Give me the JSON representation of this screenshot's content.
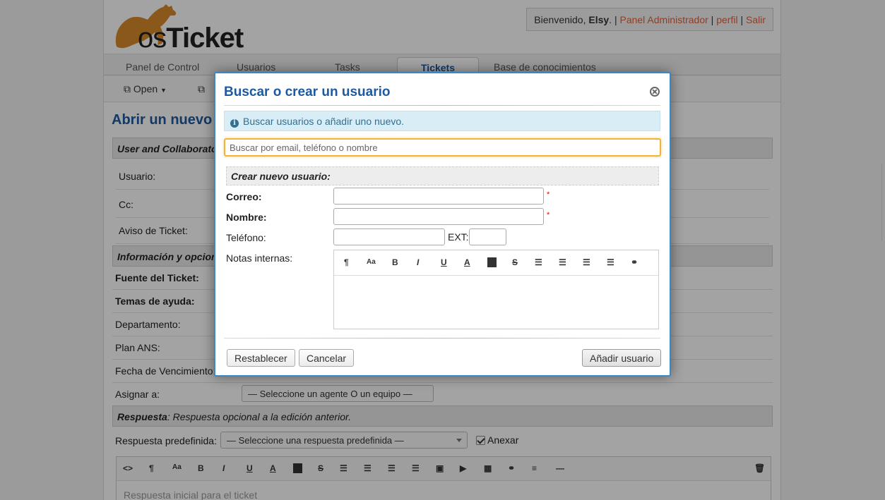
{
  "header": {
    "logo_text_os": "os",
    "logo_text_ticket": "Ticket",
    "welcome_prefix": "Bienvenido, ",
    "user_name": "Elsy",
    "welcome_suffix": ". |",
    "admin_panel": "Panel Administrador",
    "sep1": "|",
    "profile": "perfil",
    "sep2": "|",
    "logout": "Salir"
  },
  "nav": {
    "tabs": [
      {
        "label": "Panel de Control"
      },
      {
        "label": "Usuarios"
      },
      {
        "label": "Tasks"
      },
      {
        "label": "Tickets"
      },
      {
        "label": "Base de conocimientos"
      }
    ]
  },
  "subnav": {
    "open_label": "Open"
  },
  "page": {
    "title": "Abrir un nuevo T",
    "section1": "User and Collaborators",
    "user_label": "Usuario:",
    "cc_label": "Cc:",
    "notice_label": "Aviso de Ticket:",
    "section2": "Información y opciones",
    "source_label": "Fuente del Ticket:",
    "help_topics_label": "Temas de ayuda:",
    "department_label": "Departamento:",
    "sla_label": "Plan ANS:",
    "due_date_label": "Fecha de Vencimiento:",
    "assign_label": "Asignar a:",
    "assign_select": "— Seleccione un agente O un equipo —",
    "response_section_bold": "Respuesta",
    "response_section_rest": ": Respuesta opcional a la edición anterior.",
    "canned_label": "Respuesta predefinida:",
    "canned_select": "— Seleccione una respuesta predefinida —",
    "attach_label": "Anexar",
    "editor_placeholder": "Respuesta inicial para el ticket"
  },
  "dialog": {
    "title": "Buscar o crear un usuario",
    "info_icon": "i",
    "info": "Buscar usuarios o añadir uno nuevo.",
    "search_placeholder": "Buscar por email, teléfono o nombre",
    "section": "Crear nuevo usuario:",
    "email_label": "Correo:",
    "name_label": "Nombre:",
    "phone_label": "Teléfono:",
    "ext_label": "EXT:",
    "notes_label": "Notas internas:",
    "required_mark": "*",
    "reset_button": "Restablecer",
    "cancel_button": "Cancelar",
    "add_button": "Añadir usuario"
  },
  "editor_glyphs": {
    "paragraph": "¶",
    "font_size": "Aa",
    "bold": "B",
    "italic": "I",
    "underline": "U",
    "font_color": "A",
    "highlight": "A",
    "strike": "S",
    "code": "<>"
  },
  "colors": {
    "accent": "#1e5aa0",
    "link": "#e4603a",
    "info_bg": "#d9edf7",
    "focus": "#f0b43c"
  }
}
